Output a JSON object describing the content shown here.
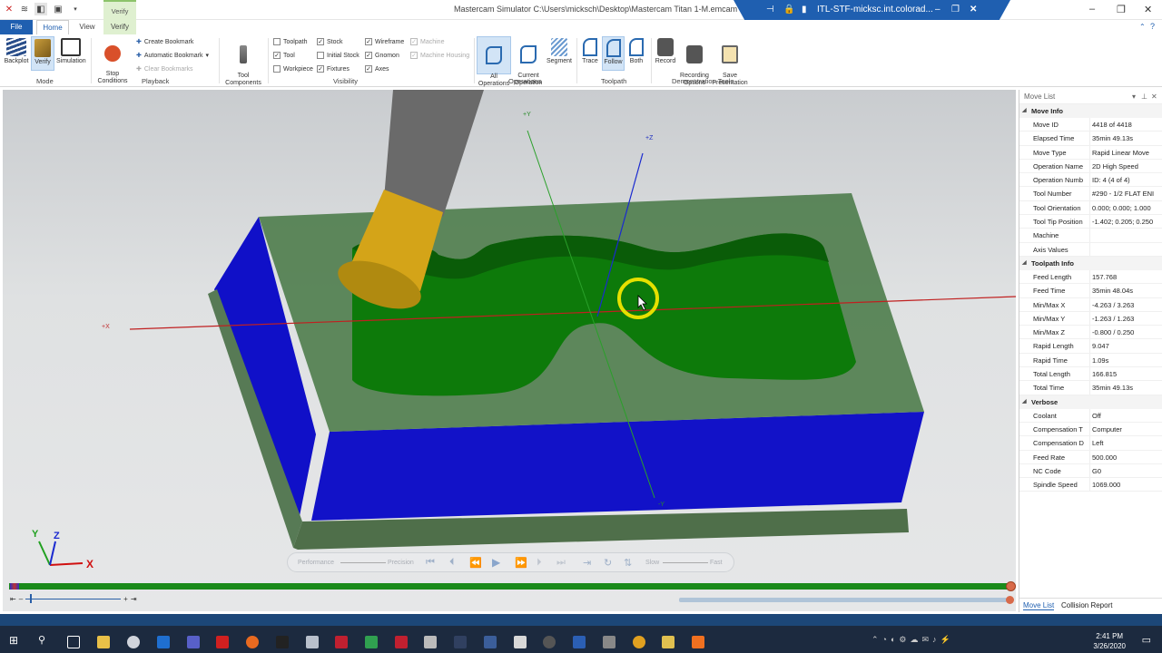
{
  "window": {
    "title": "Mastercam Simulator  C:\\Users\\micksch\\Desktop\\Mastercam Titan 1-M.emcam",
    "remote_title": "ITL-STF-micksc.int.colorad..."
  },
  "tabs": {
    "file": "File",
    "home": "Home",
    "view": "View",
    "verify_ctx": "Verify",
    "verify": "Verify"
  },
  "ribbon": {
    "mode": {
      "backplot": "Backplot",
      "verify": "Verify",
      "simulation": "Simulation",
      "label": "Mode"
    },
    "playback": {
      "stop_conditions": "Stop\nConditions",
      "create_bookmark": "Create Bookmark",
      "automatic_bookmark": "Automatic Bookmark",
      "clear_bookmarks": "Clear Bookmarks",
      "label": "Playback"
    },
    "tool_components": "Tool\nComponents",
    "visibility": {
      "label": "Visibility",
      "items": [
        {
          "label": "Toolpath",
          "checked": false
        },
        {
          "label": "Tool",
          "checked": true
        },
        {
          "label": "Workpiece",
          "checked": false
        },
        {
          "label": "Stock",
          "checked": true
        },
        {
          "label": "Initial Stock",
          "checked": false
        },
        {
          "label": "Fixtures",
          "checked": true
        },
        {
          "label": "Wireframe",
          "checked": true
        },
        {
          "label": "Gnomon",
          "checked": true
        },
        {
          "label": "Axes",
          "checked": true
        },
        {
          "label": "Machine",
          "checked": true
        },
        {
          "label": "Machine Housing",
          "checked": true
        }
      ]
    },
    "operations": {
      "all": "All\nOperations",
      "current": "Current\nOperation",
      "segment": "Segment",
      "label": "Operations"
    },
    "toolpath": {
      "trace": "Trace",
      "follow": "Follow",
      "both": "Both",
      "label": "Toolpath"
    },
    "demo": {
      "record": "Record",
      "recording_options": "Recording\nOptions",
      "save_presentation": "Save\nPresentation",
      "label": "Demonstration Tools"
    }
  },
  "viewport": {
    "axis_labels": {
      "y_plus": "+Y",
      "z_plus": "+Z",
      "x_minus": "+X",
      "y_minus": "-Y"
    },
    "gnomon": {
      "x": "X",
      "y": "Y",
      "z": "Z"
    },
    "playbar": {
      "performance": "Performance",
      "precision": "Precision",
      "slow": "Slow",
      "fast": "Fast"
    },
    "progress": 1.0
  },
  "panel": {
    "title": "Move List",
    "sections": [
      {
        "name": "Move Info",
        "rows": [
          {
            "k": "Move ID",
            "v": "4418 of 4418"
          },
          {
            "k": "Elapsed Time",
            "v": "35min 49.13s"
          },
          {
            "k": "Move Type",
            "v": "Rapid Linear Move"
          },
          {
            "k": "Operation Name",
            "v": "2D High Speed"
          },
          {
            "k": "Operation Numb",
            "v": "ID: 4 (4 of 4)"
          },
          {
            "k": "Tool Number",
            "v": "#290 - 1/2 FLAT ENI"
          },
          {
            "k": "Tool Orientation",
            "v": "0.000; 0.000; 1.000"
          },
          {
            "k": "Tool Tip Position",
            "v": "-1.402; 0.205; 0.250"
          },
          {
            "k": "Machine",
            "v": ""
          },
          {
            "k": "Axis Values",
            "v": ""
          }
        ]
      },
      {
        "name": "Toolpath Info",
        "rows": [
          {
            "k": "Feed Length",
            "v": "157.768"
          },
          {
            "k": "Feed Time",
            "v": "35min 48.04s"
          },
          {
            "k": "Min/Max X",
            "v": "-4.263 / 3.263"
          },
          {
            "k": "Min/Max Y",
            "v": "-1.263 / 1.263"
          },
          {
            "k": "Min/Max Z",
            "v": "-0.800 / 0.250"
          },
          {
            "k": "Rapid Length",
            "v": "9.047"
          },
          {
            "k": "Rapid Time",
            "v": "1.09s"
          },
          {
            "k": "Total Length",
            "v": "166.815"
          },
          {
            "k": "Total Time",
            "v": "35min 49.13s"
          }
        ]
      },
      {
        "name": "Verbose",
        "rows": [
          {
            "k": "Coolant",
            "v": "Off"
          },
          {
            "k": "Compensation T",
            "v": "Computer"
          },
          {
            "k": "Compensation D",
            "v": "Left"
          },
          {
            "k": "Feed Rate",
            "v": "500.000"
          },
          {
            "k": "NC Code",
            "v": "G0"
          },
          {
            "k": "Spindle Speed",
            "v": "1069.000"
          }
        ]
      }
    ],
    "footer": {
      "move_list": "Move List",
      "collision_report": "Collision Report"
    }
  },
  "taskbar": {
    "time": "2:41 PM",
    "date": "3/26/2020"
  },
  "colors": {
    "accent": "#1f5fb0",
    "stock_green": "#1d7a12",
    "fixture_blue": "#1010c8",
    "progress_green": "#1a8a1a"
  }
}
